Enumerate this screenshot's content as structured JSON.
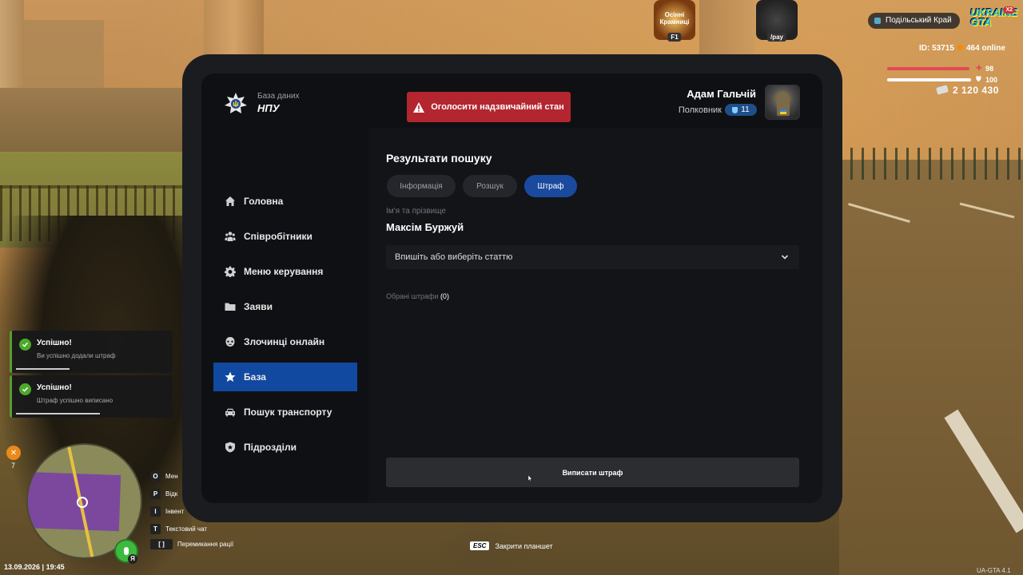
{
  "hud": {
    "region": "Подільський Край",
    "id": "ID: 53715",
    "online": "464 online",
    "health": "98",
    "armor": "100",
    "money": "2 120 430",
    "shop_label": "Осінні Крамниці",
    "shop_key": "F1",
    "pay_label": "/pay",
    "logo_text": "UKRAINE GTA",
    "logo_badge": "X2",
    "health_fraction": 0.98,
    "armor_fraction": 1.0
  },
  "tablet": {
    "brand_subtitle": "База даних",
    "brand_title": "НПУ",
    "emergency_label": "Оголосити надзвичайний стан",
    "user": {
      "name": "Адам Гальчій",
      "rank": "Полковник",
      "level": "11"
    },
    "nav": [
      {
        "label": "Головна",
        "icon": "home-icon"
      },
      {
        "label": "Співробітники",
        "icon": "people-icon"
      },
      {
        "label": "Меню керування",
        "icon": "gear-icon"
      },
      {
        "label": "Заяви",
        "icon": "folder-icon"
      },
      {
        "label": "Злочинці онлайн",
        "icon": "mask-icon"
      },
      {
        "label": "База",
        "icon": "star-icon",
        "active": true
      },
      {
        "label": "Пошук транспорту",
        "icon": "car-icon"
      },
      {
        "label": "Підрозділи",
        "icon": "shield-icon"
      }
    ],
    "results_title": "Результати пошуку",
    "tabs": [
      {
        "label": "Інформація"
      },
      {
        "label": "Розшук"
      },
      {
        "label": "Штраф",
        "active": true
      }
    ],
    "name_label": "Ім'я та прізвище",
    "name_value": "Максім Буржуй",
    "article_placeholder": "Впишіть або виберіть статтю",
    "chosen_label": "Обрані штрафи",
    "chosen_count": "(0)",
    "submit_label": "Виписати штраф"
  },
  "notifications": [
    {
      "title": "Успішно!",
      "text": "Ви успішно додали штраф",
      "progress": 0.35
    },
    {
      "title": "Успішно!",
      "text": "Штраф успішно виписано",
      "progress": 0.55
    }
  ],
  "hotkeys": [
    {
      "key": "O",
      "label": "Мен"
    },
    {
      "key": "P",
      "label": "Відк"
    },
    {
      "key": "I",
      "label": "Інвент"
    },
    {
      "key": "T",
      "label": "Текстовий чат"
    },
    {
      "key": "[ ]",
      "label": "Перемикання рації"
    }
  ],
  "bottom": {
    "esc_key": "ESC",
    "esc_label": "Закрити планшет",
    "datetime": "13.09.2026 | 19:45",
    "version": "UA-GTA 4.1",
    "mic_letter": "Я",
    "ring_count": "7"
  },
  "colors": {
    "accent": "#1249a0",
    "emergency": "#b3262f",
    "success": "#4caa2a"
  }
}
